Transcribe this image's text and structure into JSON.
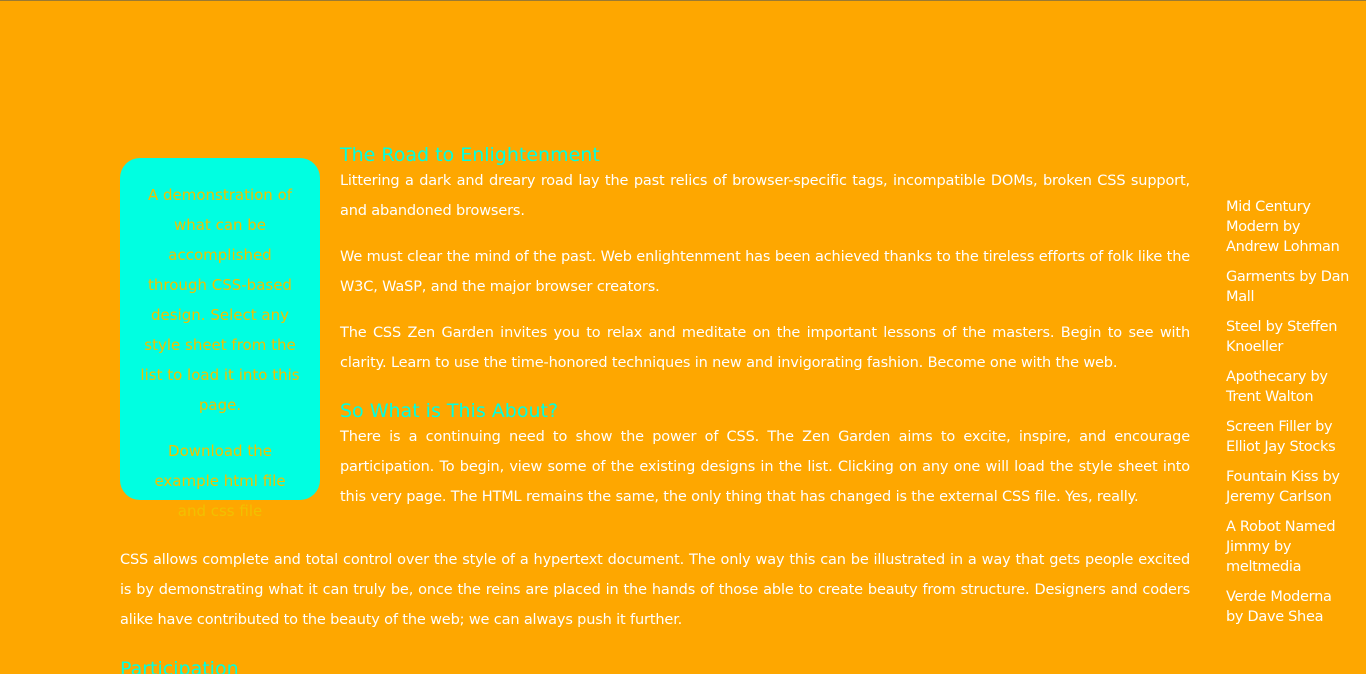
{
  "intro": {
    "summary": "A demonstration of what can be accomplished through CSS-based design. Select any style sheet from the list to load it into this page.",
    "download": "Download the example html file and css file"
  },
  "main": {
    "road_heading": "The Road to Enlightenment",
    "road_p1": "Littering a dark and dreary road lay the past relics of browser-specific tags, incompatible DOMs, broken CSS support, and abandoned browsers.",
    "road_p2": "We must clear the mind of the past. Web enlightenment has been achieved thanks to the tireless efforts of folk like the W3C, WaSP, and the major browser creators.",
    "road_p3": "The CSS Zen Garden invites you to relax and meditate on the important lessons of the masters. Begin to see with clarity. Learn to use the time-honored techniques in new and invigorating fashion. Become one with the web.",
    "about_heading": "So What is This About?",
    "about_p1": "There is a continuing need to show the power of CSS. The Zen Garden aims to excite, inspire, and encourage participation. To begin, view some of the existing designs in the list. Clicking on any one will load the style sheet into this very page. The HTML remains the same, the only thing that has changed is the external CSS file. Yes, really.",
    "about_p2": "CSS allows complete and total control over the style of a hypertext document. The only way this can be illustrated in a way that gets people excited is by demonstrating what it can truly be, once the reins are placed in the hands of those able to create beauty from structure. Designers and coders alike have contributed to the beauty of the web; we can always push it further.",
    "participation_heading": "Participation"
  },
  "designs": [
    "Mid Century Modern by Andrew Lohman",
    "Garments by Dan Mall",
    "Steel by Steffen Knoeller",
    "Apothecary by Trent Walton",
    "Screen Filler by Elliot Jay Stocks",
    "Fountain Kiss by Jeremy Carlson",
    "A Robot Named Jimmy by meltmedia",
    "Verde Moderna by Dave Shea"
  ],
  "colors": {
    "background": "#fea700",
    "accent": "#00ffe1",
    "intro_text": "#f1c000",
    "text": "#ffffff"
  }
}
